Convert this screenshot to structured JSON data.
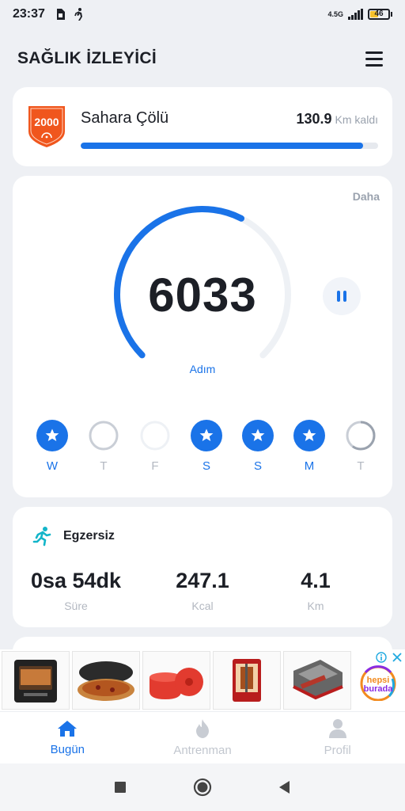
{
  "status_bar": {
    "time": "23:37",
    "network": "4.5G",
    "battery": "46",
    "battery_level": 0.46,
    "icons": [
      "sim-icon",
      "walking-icon",
      "signal-icon",
      "battery-icon"
    ]
  },
  "header": {
    "title": "SAĞLIK İZLEYİCİ",
    "menu_icon": "hamburger-menu-icon"
  },
  "challenge": {
    "badge_text": "2000",
    "name": "Sahara Çölü",
    "remaining_value": "130.9",
    "remaining_unit": "Km kaldı",
    "progress_fraction": 0.95,
    "badge_color": "#f0561d"
  },
  "steps": {
    "more_label": "Daha",
    "count": "6033",
    "unit_label": "Adım",
    "goal_fraction": 0.6,
    "pause_icon": "pause-icon",
    "accent_color": "#1a73e8",
    "week": [
      {
        "label": "W",
        "state": "done"
      },
      {
        "label": "T",
        "state": "partial",
        "fraction": 0.0
      },
      {
        "label": "F",
        "state": "empty",
        "fraction": 0.0
      },
      {
        "label": "S",
        "state": "done"
      },
      {
        "label": "S",
        "state": "done"
      },
      {
        "label": "M",
        "state": "done"
      },
      {
        "label": "T",
        "state": "partial",
        "fraction": 0.6
      }
    ]
  },
  "exercise": {
    "title": "Egzersiz",
    "icon": "running-icon",
    "stats": [
      {
        "value": "0sa 54dk",
        "label": "Süre"
      },
      {
        "value": "247.1",
        "label": "Kcal"
      },
      {
        "value": "4.1",
        "label": "Km"
      }
    ]
  },
  "ad": {
    "brand": [
      "hepsi",
      "burada"
    ],
    "items": [
      "air-fryer-image",
      "pizza-oven-image",
      "silicone-pot-image",
      "rotisserie-image",
      "grill-image"
    ]
  },
  "bottom_nav": [
    {
      "label": "Bugün",
      "icon": "home-icon",
      "active": true
    },
    {
      "label": "Antrenman",
      "icon": "flame-icon",
      "active": false
    },
    {
      "label": "Profil",
      "icon": "person-icon",
      "active": false
    }
  ],
  "system_nav": [
    "recents-square-icon",
    "home-circle-icon",
    "back-triangle-icon"
  ]
}
